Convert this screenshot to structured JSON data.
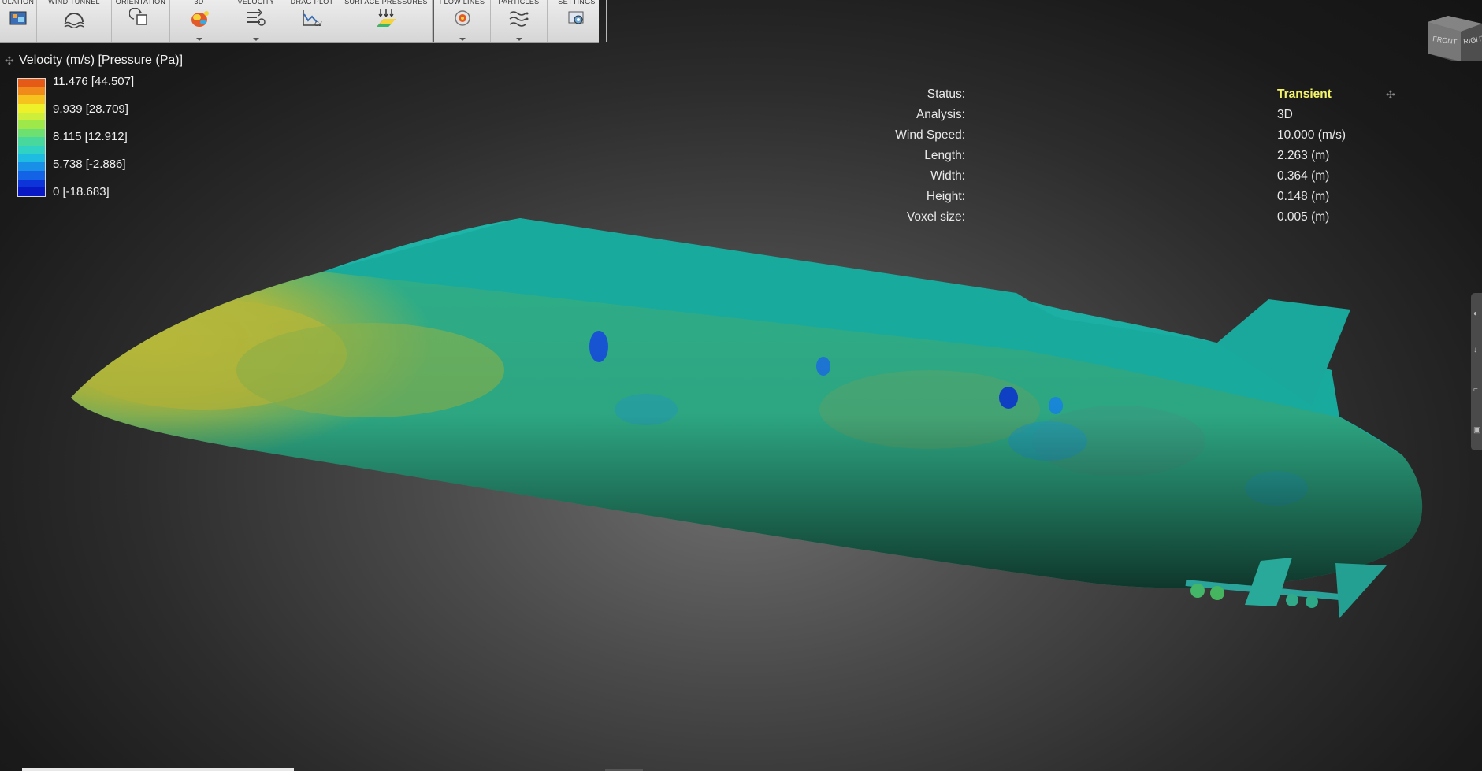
{
  "toolbar": {
    "groups": [
      [
        {
          "label": "ULATION",
          "icon": "simulation-icon"
        },
        {
          "label": "WIND TUNNEL",
          "icon": "wind-tunnel-icon"
        },
        {
          "label": "ORIENTATION",
          "icon": "orientation-icon"
        },
        {
          "label": "3D",
          "icon": "3d-icon"
        },
        {
          "label": "VELOCITY",
          "icon": "velocity-icon"
        },
        {
          "label": "DRAG PLOT",
          "icon": "drag-plot-icon"
        },
        {
          "label": "SURFACE PRESSURES",
          "icon": "surface-pressures-icon"
        }
      ],
      [
        {
          "label": "FLOW LINES",
          "icon": "flow-lines-icon"
        },
        {
          "label": "PARTICLES",
          "icon": "particles-icon"
        },
        {
          "label": "SETTINGS",
          "icon": "settings-icon"
        }
      ]
    ]
  },
  "legend": {
    "title": "Velocity (m/s) [Pressure (Pa)]",
    "values": [
      "11.476 [44.507]",
      "9.939 [28.709]",
      "8.115 [12.912]",
      "5.738 [-2.886]",
      "0 [-18.683]"
    ],
    "colors": [
      "#e65a18",
      "#f08a1a",
      "#f5c21e",
      "#eef02a",
      "#cdee3a",
      "#9ee84a",
      "#6ee072",
      "#48d89e",
      "#30d2c4",
      "#1ebce0",
      "#1890e8",
      "#1462e6",
      "#0c34d8",
      "#0818c4"
    ]
  },
  "info": {
    "rows": [
      {
        "label": "Status:",
        "value": "Transient"
      },
      {
        "label": "Analysis:",
        "value": "3D"
      },
      {
        "label": "Wind Speed:",
        "value": "10.000 (m/s)"
      },
      {
        "label": "Length:",
        "value": "2.263 (m)"
      },
      {
        "label": "Width:",
        "value": "0.364 (m)"
      },
      {
        "label": "Height:",
        "value": "0.148 (m)"
      },
      {
        "label": "Voxel size:",
        "value": "0.005 (m)"
      }
    ],
    "status_color": "#f3f36a"
  },
  "viewcube": {
    "front": "FRONT",
    "right": "RIGHT"
  }
}
